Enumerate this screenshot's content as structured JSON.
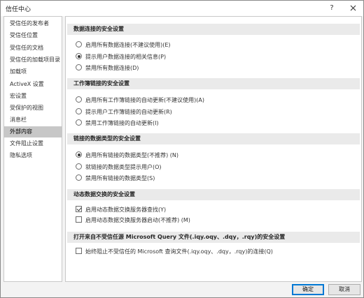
{
  "window": {
    "title": "信任中心",
    "help_label": "?"
  },
  "sidebar": {
    "items": [
      {
        "label": "受信任的发布者"
      },
      {
        "label": "受信任位置"
      },
      {
        "label": "受信任的文档"
      },
      {
        "label": "受信任的加载项目录"
      },
      {
        "label": "加载项"
      },
      {
        "label": "ActiveX 设置"
      },
      {
        "label": "宏设置"
      },
      {
        "label": "受保护的视图"
      },
      {
        "label": "消息栏"
      },
      {
        "label": "外部内容",
        "selected": true
      },
      {
        "label": "文件阻止设置"
      },
      {
        "label": "隐私选项"
      }
    ]
  },
  "sections": [
    {
      "title": "数据连接的安全设置",
      "options": [
        {
          "label": "启用所有数据连接(不建议使用)(E)",
          "checked": false
        },
        {
          "label": "提示用户数据连接的相关信息(P)",
          "checked": true
        },
        {
          "label": "禁用所有数据连接(D)",
          "checked": false
        }
      ]
    },
    {
      "title": "工作簿链接的安全设置",
      "options": [
        {
          "label": "启用所有工作簿链接的自动更新(不建议使用)(A)",
          "checked": false
        },
        {
          "label": "提示用户工作簿链接的自动更新(R)",
          "checked": false
        },
        {
          "label": "禁用工作簿链接的自动更新(I)",
          "checked": false
        }
      ]
    },
    {
      "title": "链接的数据类型的安全设置",
      "options": [
        {
          "label": "启用所有链接的数据类型(不推荐) (N)",
          "checked": true
        },
        {
          "label": "就链接的数据类型提示用户(O)",
          "checked": false
        },
        {
          "label": "禁用所有链接的数据类型(S)",
          "checked": false
        }
      ]
    },
    {
      "title": "动态数据交换的安全设置",
      "checks": [
        {
          "label": "启用动态数据交换服务器查找(Y)",
          "checked": true
        },
        {
          "label": "启用动态数据交换服务器启动(不推荐) (M)",
          "checked": false
        }
      ]
    },
    {
      "title": "打开来自不受信任源 Microsoft Query 文件(.iqy.oqy、.dqy，.rqy)的安全设置",
      "checks": [
        {
          "label": "始终阻止不受信任的 Microsoft 查询文件(.iqy.oqy、.dqy，.rqy)的连接(Q)",
          "checked": false
        }
      ]
    }
  ],
  "footer": {
    "ok_label": "确定",
    "cancel_label": "取消"
  },
  "colors": {
    "accent": "#0078d4",
    "selected": "#c7c7c7",
    "section_bg": "#eaeaea"
  }
}
